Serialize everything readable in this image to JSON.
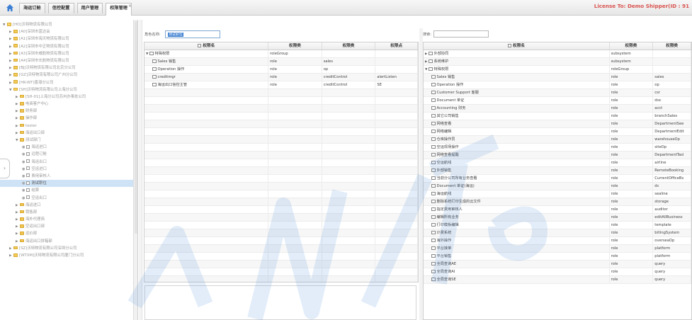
{
  "topbar": {
    "tabs": [
      {
        "label": "海运订舱",
        "active": false
      },
      {
        "label": "信控配置",
        "active": false
      },
      {
        "label": "用户管理",
        "active": false
      },
      {
        "label": "权限管理",
        "active": true
      }
    ],
    "close_glyph": "×",
    "license": "License To: Demo Shipper(ID : 91"
  },
  "tree": {
    "items": [
      {
        "label": "[HO]沃特物流有限公司",
        "indent": 0,
        "arrow": "▼",
        "icon": "folder-open"
      },
      {
        "label": "[A0]深圳市蓝达会",
        "indent": 1,
        "arrow": "▶",
        "icon": "folder"
      },
      {
        "label": "[A1]深圳市海天物流有限公司",
        "indent": 1,
        "arrow": "▶",
        "icon": "folder"
      },
      {
        "label": "[A2]深圳市中正物流有限公司",
        "indent": 1,
        "arrow": "▶",
        "icon": "folder"
      },
      {
        "label": "[A3]深圳市威航物流有限公司",
        "indent": 1,
        "arrow": "▶",
        "icon": "folder"
      },
      {
        "label": "[A4]深圳市长航物流有限公司",
        "indent": 1,
        "arrow": "▶",
        "icon": "folder"
      },
      {
        "label": "[BJ]沃特物流有限公司北京分公司",
        "indent": 1,
        "arrow": "▶",
        "icon": "folder"
      },
      {
        "label": "[GZ]沃特物流有限公司广州分公司",
        "indent": 1,
        "arrow": "▶",
        "icon": "folder"
      },
      {
        "label": "[HK-WT]香港分公司",
        "indent": 1,
        "arrow": "▶",
        "icon": "folder"
      },
      {
        "label": "[SH]沃特物流有限公司上海分公司",
        "indent": 1,
        "arrow": "▼",
        "icon": "folder-open"
      },
      {
        "label": "[SH-01]上海分公司苏州办事处公司",
        "indent": 2,
        "arrow": "▶",
        "icon": "folder"
      },
      {
        "label": "电商客户中心",
        "indent": 2,
        "arrow": "▶",
        "icon": "user-folder"
      },
      {
        "label": "财务部",
        "indent": 2,
        "arrow": "▶",
        "icon": "user-folder"
      },
      {
        "label": "操作部",
        "indent": 2,
        "arrow": "▶",
        "icon": "user-folder"
      },
      {
        "label": "tester",
        "indent": 2,
        "arrow": "▶",
        "icon": "user-folder"
      },
      {
        "label": "海运出口部",
        "indent": 2,
        "arrow": "▶",
        "icon": "user-folder"
      },
      {
        "label": "测试部门",
        "indent": 2,
        "arrow": "▼",
        "icon": "user-folder"
      },
      {
        "label": "海运进口",
        "indent": 3,
        "arrow": "●",
        "icon": "file"
      },
      {
        "label": "远程订舱",
        "indent": 3,
        "arrow": "●",
        "icon": "file"
      },
      {
        "label": "海运出口",
        "indent": 3,
        "arrow": "●",
        "icon": "file"
      },
      {
        "label": "空运进口",
        "indent": 3,
        "arrow": "●",
        "icon": "file"
      },
      {
        "label": "费用审核人",
        "indent": 3,
        "arrow": "●",
        "icon": "file"
      },
      {
        "label": "测试职位",
        "indent": 3,
        "arrow": "●",
        "icon": "file",
        "highlight": true
      },
      {
        "label": "结算",
        "indent": 3,
        "arrow": "●",
        "icon": "file"
      },
      {
        "label": "空运出口",
        "indent": 3,
        "arrow": "●",
        "icon": "file"
      },
      {
        "label": "海运进口",
        "indent": 2,
        "arrow": "▶",
        "icon": "user-folder"
      },
      {
        "label": "销售部",
        "indent": 2,
        "arrow": "▶",
        "icon": "user-folder"
      },
      {
        "label": "海外代理商",
        "indent": 2,
        "arrow": "▶",
        "icon": "user-folder"
      },
      {
        "label": "空运出口部",
        "indent": 2,
        "arrow": "▶",
        "icon": "user-folder"
      },
      {
        "label": "运价部",
        "indent": 2,
        "arrow": "▶",
        "icon": "user-folder"
      },
      {
        "label": "海运出口拼箱部",
        "indent": 2,
        "arrow": "▶",
        "icon": "user-folder"
      },
      {
        "label": "[SZ]沃特物流有限公司深圳分公司",
        "indent": 1,
        "arrow": "▶",
        "icon": "folder"
      },
      {
        "label": "[WTXM]沃特物流有限公司厦门分公司",
        "indent": 1,
        "arrow": "▶",
        "icon": "folder"
      }
    ]
  },
  "role_panel": {
    "name_label": "角色名称:",
    "name_value": "测试职位",
    "columns": [
      "权限名",
      "权限类",
      "权限类",
      "权限点"
    ],
    "rows": [
      {
        "name": "特殊权限",
        "type": "roleGroup",
        "value": "",
        "point": "",
        "arrow": "▼",
        "checkbox": true,
        "indent": 0
      },
      {
        "name": "Sales 销售",
        "type": "role",
        "value": "sales",
        "point": "",
        "arrow": "",
        "checkbox": true,
        "indent": 1
      },
      {
        "name": "Operation 操作",
        "type": "role",
        "value": "op",
        "point": "",
        "arrow": "",
        "checkbox": true,
        "indent": 1
      },
      {
        "name": "creditmgr",
        "type": "role",
        "value": "creditControl",
        "point": "alertListen",
        "arrow": "",
        "checkbox": true,
        "indent": 1
      },
      {
        "name": "海运出口信控主管",
        "type": "role",
        "value": "creditControl",
        "point": "SE",
        "arrow": "",
        "checkbox": true,
        "indent": 1
      }
    ]
  },
  "right_panel": {
    "search_label": "搜索:",
    "search_value": "",
    "columns": [
      "权限名",
      "权限类",
      "权限类"
    ],
    "rows": [
      {
        "name": "外部协同",
        "type": "subsystem",
        "value": "",
        "arrow": "▶",
        "indent": 0
      },
      {
        "name": "系统维护",
        "type": "subsystem",
        "value": "",
        "arrow": "▶",
        "indent": 0
      },
      {
        "name": "特殊权限",
        "type": "roleGroup",
        "value": "",
        "arrow": "▼",
        "indent": 0
      },
      {
        "name": "Sales 销售",
        "type": "role",
        "value": "sales",
        "arrow": "",
        "indent": 1
      },
      {
        "name": "Operation 操作",
        "type": "role",
        "value": "op",
        "arrow": "",
        "indent": 1
      },
      {
        "name": "Customer Support 客服",
        "type": "role",
        "value": "csr",
        "arrow": "",
        "indent": 1
      },
      {
        "name": "Document 单证",
        "type": "role",
        "value": "doc",
        "arrow": "",
        "indent": 1
      },
      {
        "name": "Accounting 财务",
        "type": "role",
        "value": "acct",
        "arrow": "",
        "indent": 1
      },
      {
        "name": "其它公司销售",
        "type": "role",
        "value": "branchSales",
        "arrow": "",
        "indent": 1
      },
      {
        "name": "网络查看",
        "type": "role",
        "value": "DepartmentSee",
        "arrow": "",
        "indent": 1
      },
      {
        "name": "网络编辑",
        "type": "role",
        "value": "DepartmentEdit",
        "arrow": "",
        "indent": 1
      },
      {
        "name": "仓库操作员",
        "type": "role",
        "value": "warehouseOp",
        "arrow": "",
        "indent": 1
      },
      {
        "name": "空运现场操作",
        "type": "role",
        "value": "siteOp",
        "arrow": "",
        "indent": 1
      },
      {
        "name": "网络查看提醒",
        "type": "role",
        "value": "DepartmentTasl",
        "arrow": "",
        "indent": 1
      },
      {
        "name": "空运航线",
        "type": "role",
        "value": "airline",
        "arrow": "",
        "indent": 1
      },
      {
        "name": "外部销售",
        "type": "role",
        "value": "RemoteBooking",
        "arrow": "",
        "indent": 1
      },
      {
        "name": "当前分公司所有业务查看",
        "type": "role",
        "value": "CurrentOfficeBs",
        "arrow": "",
        "indent": 1
      },
      {
        "name": "Document 单证(海运)",
        "type": "role",
        "value": "dc",
        "arrow": "",
        "indent": 1
      },
      {
        "name": "海运航线",
        "type": "role",
        "value": "sealine",
        "arrow": "",
        "indent": 1
      },
      {
        "name": "删除系统打印生成的云文件",
        "type": "role",
        "value": "storage",
        "arrow": "",
        "indent": 1
      },
      {
        "name": "指定费用审核人",
        "type": "role",
        "value": "auditor",
        "arrow": "",
        "indent": 1
      },
      {
        "name": "编辑所有业务",
        "type": "role",
        "value": "editAllBusiness",
        "arrow": "",
        "indent": 1
      },
      {
        "name": "打印模板编辑",
        "type": "role",
        "value": "template",
        "arrow": "",
        "indent": 1
      },
      {
        "name": "计费系统",
        "type": "role",
        "value": "billingSystem",
        "arrow": "",
        "indent": 1
      },
      {
        "name": "海外操作",
        "type": "role",
        "value": "overseaOp",
        "arrow": "",
        "indent": 1
      },
      {
        "name": "平台接单",
        "type": "role",
        "value": "platform",
        "arrow": "",
        "indent": 1
      },
      {
        "name": "平台销售",
        "type": "role",
        "value": "platform",
        "arrow": "",
        "indent": 1
      },
      {
        "name": "全局查询AE",
        "type": "role",
        "value": "query",
        "arrow": "",
        "indent": 1
      },
      {
        "name": "全局查询AI",
        "type": "role",
        "value": "query",
        "arrow": "",
        "indent": 1
      },
      {
        "name": "全局查询SE",
        "type": "role",
        "value": "query",
        "arrow": "",
        "indent": 1
      }
    ]
  },
  "colors": {
    "accent": "#3d7fd1",
    "highlight": "#cfe3f7",
    "license": "#d9534f",
    "watermark": "#4a90d9"
  },
  "icons": [
    "home-icon",
    "folder-icon",
    "close-icon",
    "expand-icon",
    "checkbox-icon"
  ]
}
